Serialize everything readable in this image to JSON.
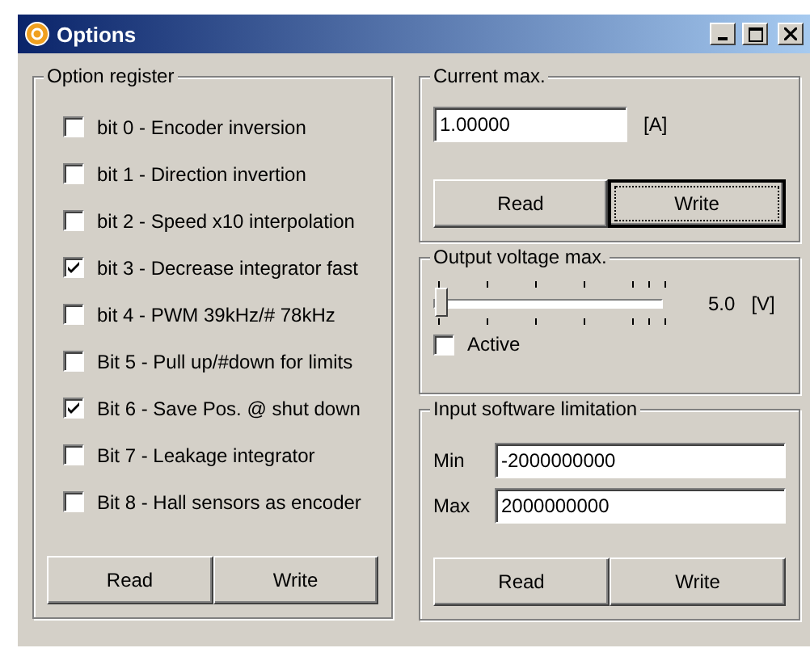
{
  "window": {
    "title": "Options"
  },
  "option_register": {
    "title": "Option register",
    "bits": [
      {
        "label": "bit 0 - Encoder inversion",
        "checked": false
      },
      {
        "label": "bit 1 - Direction invertion",
        "checked": false
      },
      {
        "label": "bit 2 - Speed x10 interpolation",
        "checked": false
      },
      {
        "label": "bit 3 - Decrease integrator fast",
        "checked": true
      },
      {
        "label": "bit 4 - PWM 39kHz/# 78kHz",
        "checked": false
      },
      {
        "label": "Bit 5 - Pull up/#down for limits",
        "checked": false
      },
      {
        "label": "Bit 6 - Save Pos. @ shut down",
        "checked": true
      },
      {
        "label": "Bit 7 - Leakage integrator",
        "checked": false
      },
      {
        "label": "Bit 8 - Hall sensors as encoder",
        "checked": false
      }
    ],
    "buttons": [
      {
        "label": "Read",
        "focused": false
      },
      {
        "label": "Write",
        "focused": false
      }
    ]
  },
  "current_max": {
    "title": "Current max.",
    "value": "1.00000",
    "unit": "[A]",
    "buttons": [
      {
        "label": "Read",
        "focused": false
      },
      {
        "label": "Write",
        "focused": true
      }
    ]
  },
  "output_voltage": {
    "title": "Output voltage max.",
    "level": 0.0,
    "reading": "5.0",
    "unit": "[V]",
    "active": {
      "label": "Active",
      "checked": false
    }
  },
  "input_limit": {
    "title": "Input software limitation",
    "fields": [
      {
        "label": "Min",
        "value": "-2000000000"
      },
      {
        "label": "Max",
        "value": "2000000000"
      }
    ],
    "buttons": [
      {
        "label": "Read",
        "focused": false
      },
      {
        "label": "Write",
        "focused": false
      }
    ]
  }
}
